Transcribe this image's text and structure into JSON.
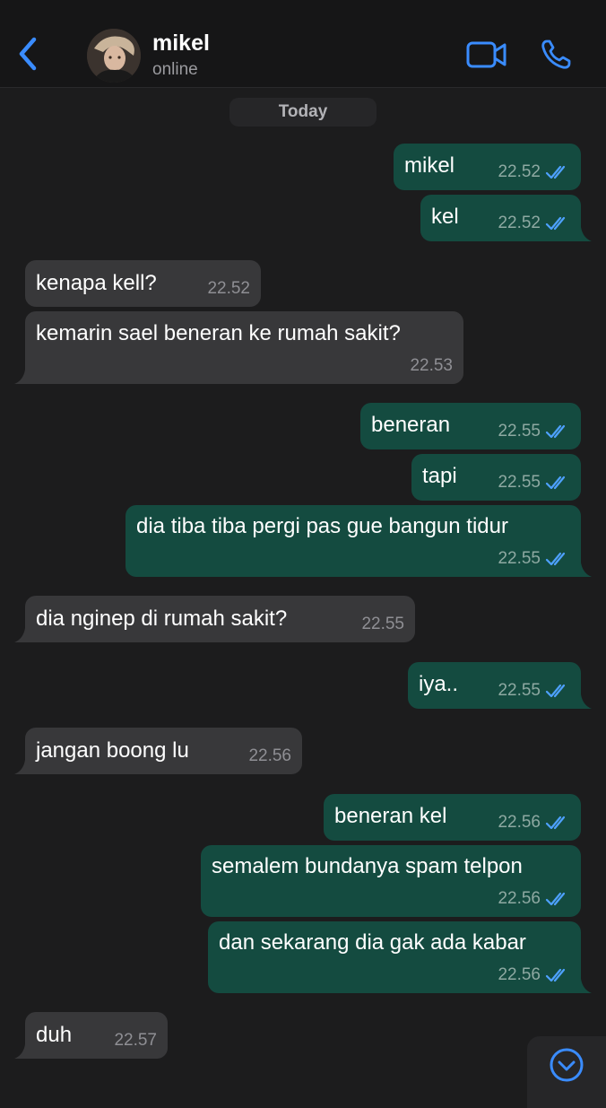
{
  "header": {
    "contact_name": "mikel",
    "status": "online"
  },
  "date_chip": "Today",
  "colors": {
    "accent": "#3a8cff",
    "outgoing_bubble": "#144b40",
    "incoming_bubble": "#38383a",
    "background": "#1c1c1d",
    "read_ticks": "#4ea1ff"
  },
  "icons": [
    "chevron-left-icon",
    "video-call-icon",
    "phone-icon",
    "double-check-icon",
    "chevron-down-icon"
  ],
  "messages": [
    {
      "dir": "out",
      "text": "mikel",
      "time": "22.52",
      "read": true
    },
    {
      "dir": "out",
      "text": "kel",
      "time": "22.52",
      "read": true
    },
    {
      "dir": "in",
      "text": "kenapa kell?",
      "time": "22.52"
    },
    {
      "dir": "in",
      "text": "kemarin sael beneran ke rumah sakit?",
      "time": "22.53"
    },
    {
      "dir": "out",
      "text": "beneran",
      "time": "22.55",
      "read": true
    },
    {
      "dir": "out",
      "text": "tapi",
      "time": "22.55",
      "read": true
    },
    {
      "dir": "out",
      "text": "dia tiba tiba pergi pas gue bangun tidur",
      "time": "22.55",
      "read": true
    },
    {
      "dir": "in",
      "text": "dia nginep di rumah sakit?",
      "time": "22.55"
    },
    {
      "dir": "out",
      "text": "iya..",
      "time": "22.55",
      "read": true
    },
    {
      "dir": "in",
      "text": "jangan boong lu",
      "time": "22.56"
    },
    {
      "dir": "out",
      "text": "beneran kel",
      "time": "22.56",
      "read": true
    },
    {
      "dir": "out",
      "text": "semalem bundanya spam telpon",
      "time": "22.56",
      "read": true
    },
    {
      "dir": "out",
      "text": "dan sekarang dia gak ada kabar",
      "time": "22.56",
      "read": true
    },
    {
      "dir": "in",
      "text": "duh",
      "time": "22.57"
    }
  ]
}
